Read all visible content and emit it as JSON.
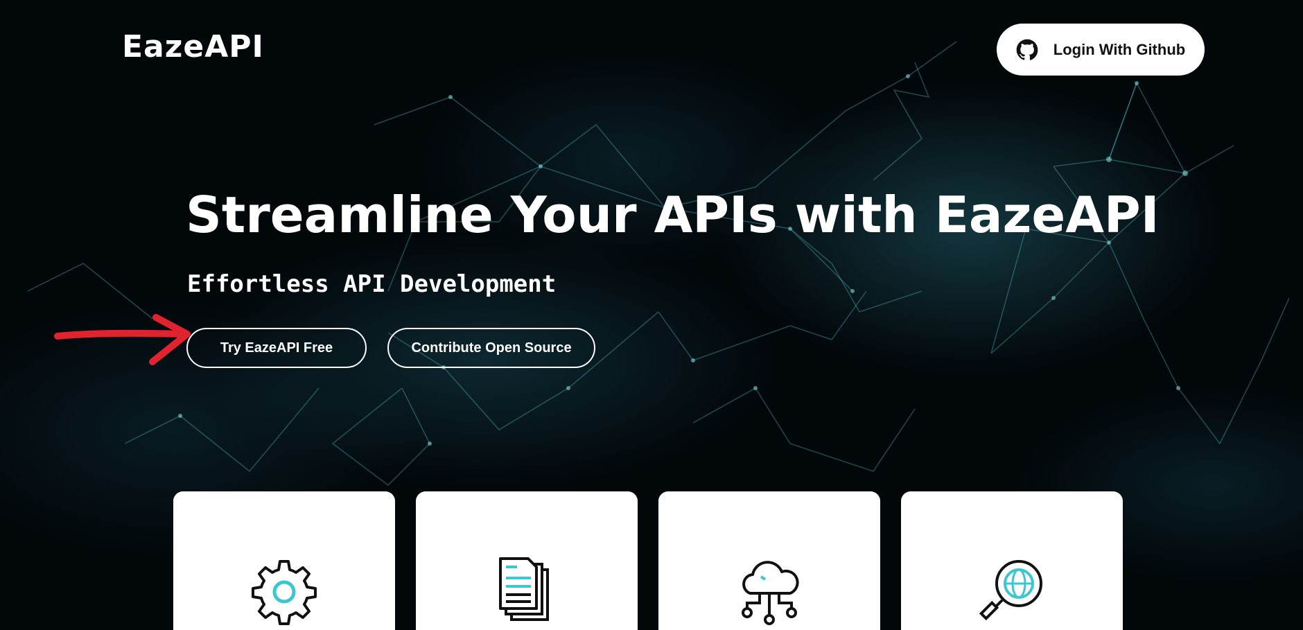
{
  "header": {
    "logo_text": "EazeAPI",
    "login_button": {
      "label": "Login With Github",
      "icon": "github-icon"
    }
  },
  "hero": {
    "title": "Streamline Your APIs with EazeAPI",
    "subtitle": "Effortless API Development",
    "buttons": {
      "try_free": "Try EazeAPI Free",
      "contribute": "Contribute Open Source"
    }
  },
  "feature_cards": [
    {
      "icon": "gear-icon"
    },
    {
      "icon": "documents-icon"
    },
    {
      "icon": "cloud-network-icon"
    },
    {
      "icon": "globe-search-icon"
    }
  ],
  "annotation": {
    "icon": "red-arrow-icon"
  },
  "colors": {
    "background": "#02070a",
    "accent": "#3cc6d0",
    "arrow": "#e0232e",
    "text": "#ffffff"
  }
}
